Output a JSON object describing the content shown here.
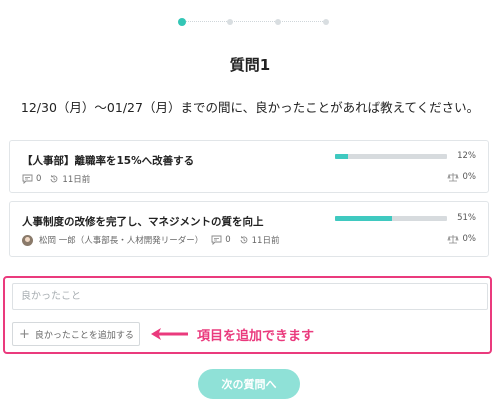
{
  "stepper": {
    "steps": 4,
    "current": 1
  },
  "question": {
    "title": "質問1",
    "text": "12/30（月）〜01/27（月）までの間に、良かったことがあれば教えてください。"
  },
  "cards": [
    {
      "title": "【人事部】離職率を15%へ改善する",
      "comments": "0",
      "date": "11日前",
      "progress_pct": 12,
      "progress_label": "12%",
      "rate_label": "0%"
    },
    {
      "title": "人事制度の改修を完了し、マネジメントの質を向上",
      "owner": "松岡 一郎（人事部長・人材開発リーダー）",
      "comments": "0",
      "date": "11日前",
      "progress_pct": 51,
      "progress_label": "51%",
      "rate_label": "0%"
    }
  ],
  "form": {
    "placeholder": "良かったこと",
    "add_label": "良かったことを追加する"
  },
  "annotation": "項目を追加できます",
  "next_label": "次の質問へ",
  "colors": {
    "accent": "#34c6b6",
    "highlight": "#ea3a7d",
    "next_button": "#8fe1d7"
  }
}
